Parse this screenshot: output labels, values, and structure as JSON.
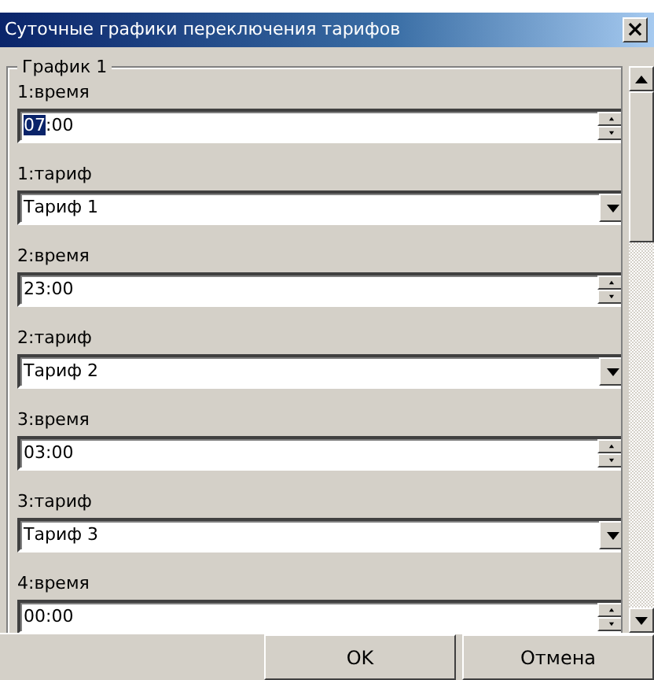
{
  "window": {
    "title": "Суточные графики переключения тарифов",
    "close": "×"
  },
  "group": {
    "title": "График 1"
  },
  "items": [
    {
      "kind": "time",
      "label": "1:время",
      "value_parts": [
        {
          "text": "07",
          "selected": true
        },
        {
          "text": ":00",
          "selected": false
        }
      ]
    },
    {
      "kind": "tariff",
      "label": "1:тариф",
      "value_parts": [
        {
          "text": "Тариф 1",
          "selected": false
        }
      ]
    },
    {
      "kind": "time",
      "label": "2:время",
      "value_parts": [
        {
          "text": "23:00",
          "selected": false
        }
      ]
    },
    {
      "kind": "tariff",
      "label": "2:тариф",
      "value_parts": [
        {
          "text": "Тариф 2",
          "selected": false
        }
      ]
    },
    {
      "kind": "time",
      "label": "3:время",
      "value_parts": [
        {
          "text": "03:00",
          "selected": false
        }
      ]
    },
    {
      "kind": "tariff",
      "label": "3:тариф",
      "value_parts": [
        {
          "text": "Тариф 3",
          "selected": false
        }
      ]
    },
    {
      "kind": "time",
      "label": "4:время",
      "value_parts": [
        {
          "text": "00:00",
          "selected": false
        }
      ]
    }
  ],
  "buttons": [
    "OK",
    "Отмена"
  ]
}
